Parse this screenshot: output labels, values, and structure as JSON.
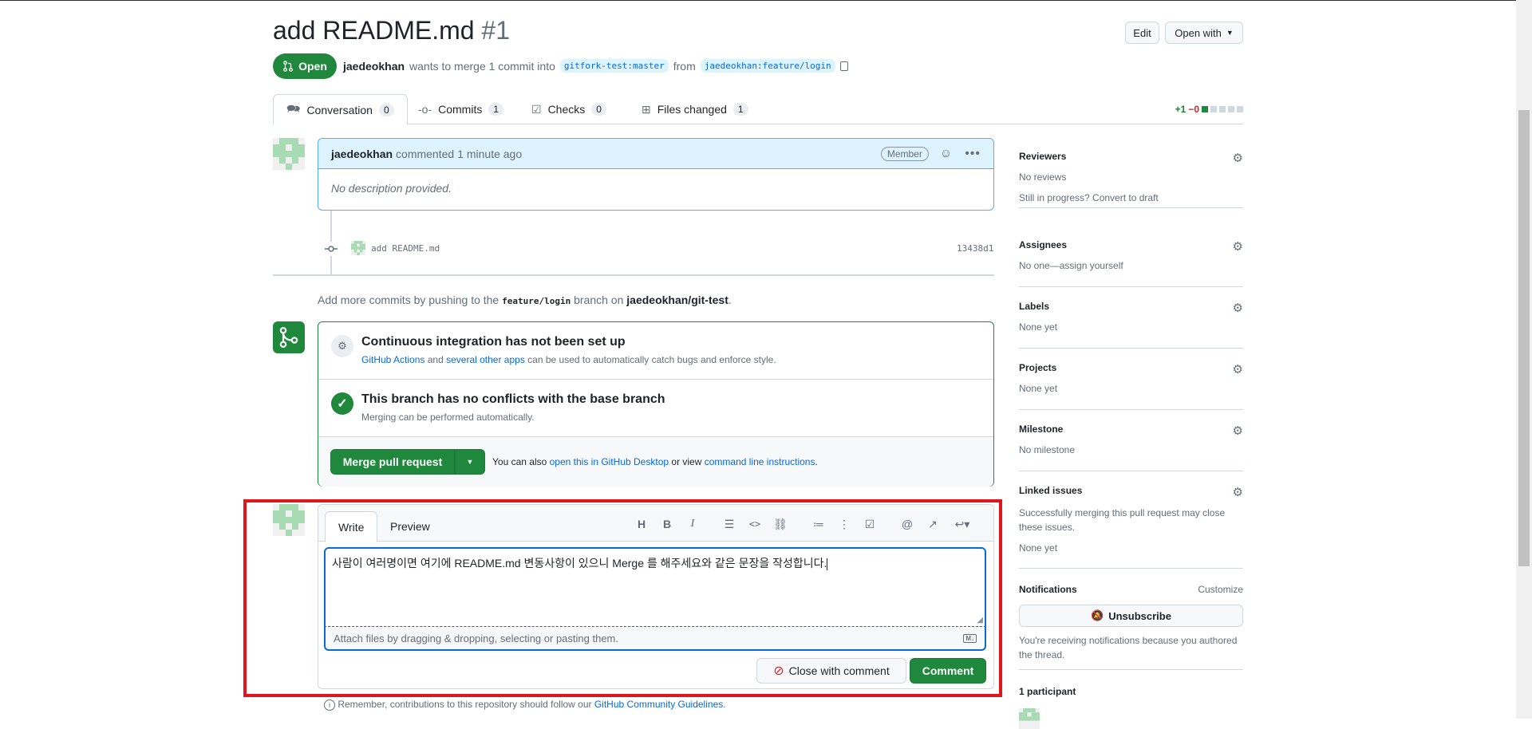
{
  "header": {
    "title": "add README.md",
    "number": "#1",
    "edit_label": "Edit",
    "open_with_label": "Open with"
  },
  "pr_meta": {
    "state": "Open",
    "author": "jaedeokhan",
    "merge_text": "wants to merge 1 commit into",
    "base_branch": "gitfork-test:master",
    "from_text": "from",
    "head_branch": "jaedeokhan:feature/login"
  },
  "tabs": [
    {
      "label": "Conversation",
      "count": "0"
    },
    {
      "label": "Commits",
      "count": "1"
    },
    {
      "label": "Checks",
      "count": "0"
    },
    {
      "label": "Files changed",
      "count": "1"
    }
  ],
  "diffstat": {
    "additions": "+1",
    "deletions": "−0"
  },
  "comment": {
    "author": "jaedeokhan",
    "action": "commented",
    "time": "1 minute ago",
    "badge": "Member",
    "body": "No description provided."
  },
  "commit": {
    "message": "add README.md",
    "sha": "13438d1"
  },
  "add_more": {
    "prefix": "Add more commits by pushing to the",
    "branch": "feature/login",
    "mid": "branch on",
    "repo": "jaedeokhan/git-test",
    "suffix": "."
  },
  "merge": {
    "ci_title": "Continuous integration has not been set up",
    "ci_link1": "GitHub Actions",
    "ci_and": "and",
    "ci_link2": "several other apps",
    "ci_rest": "can be used to automatically catch bugs and enforce style.",
    "conflict_title": "This branch has no conflicts with the base branch",
    "conflict_sub": "Merging can be performed automatically.",
    "merge_button": "Merge pull request",
    "also_text": "You can also",
    "desktop_link": "open this in GitHub Desktop",
    "or_view": "or view",
    "cli_link": "command line instructions",
    "period": "."
  },
  "editor": {
    "write_tab": "Write",
    "preview_tab": "Preview",
    "text": "사람이 여러명이면 여기에 README.md 변동사항이 있으니 Merge 를 해주세요와 같은 문장을 작성합니다.",
    "attach_text": "Attach files by dragging & dropping, selecting or pasting them.",
    "close_button": "Close with comment",
    "comment_button": "Comment",
    "toolbar": [
      "H",
      "B",
      "I"
    ]
  },
  "guidelines": {
    "prefix": "Remember, contributions to this repository should follow our",
    "link": "GitHub Community Guidelines",
    "suffix": "."
  },
  "sidebar": {
    "reviewers": {
      "title": "Reviewers",
      "value": "No reviews",
      "extra": "Still in progress? Convert to draft"
    },
    "assignees": {
      "title": "Assignees",
      "value": "No one—assign yourself"
    },
    "labels": {
      "title": "Labels",
      "value": "None yet"
    },
    "projects": {
      "title": "Projects",
      "value": "None yet"
    },
    "milestone": {
      "title": "Milestone",
      "value": "No milestone"
    },
    "linked": {
      "title": "Linked issues",
      "desc": "Successfully merging this pull request may close these issues.",
      "value": "None yet"
    },
    "notifications": {
      "title": "Notifications",
      "customize": "Customize",
      "button": "Unsubscribe",
      "desc": "You're receiving notifications because you authored the thread."
    },
    "participants": {
      "title": "1 participant"
    }
  },
  "colors": {
    "accent": "#0969da",
    "success": "#1f883d",
    "danger": "#cf222e",
    "highlight": "#e0161d"
  }
}
